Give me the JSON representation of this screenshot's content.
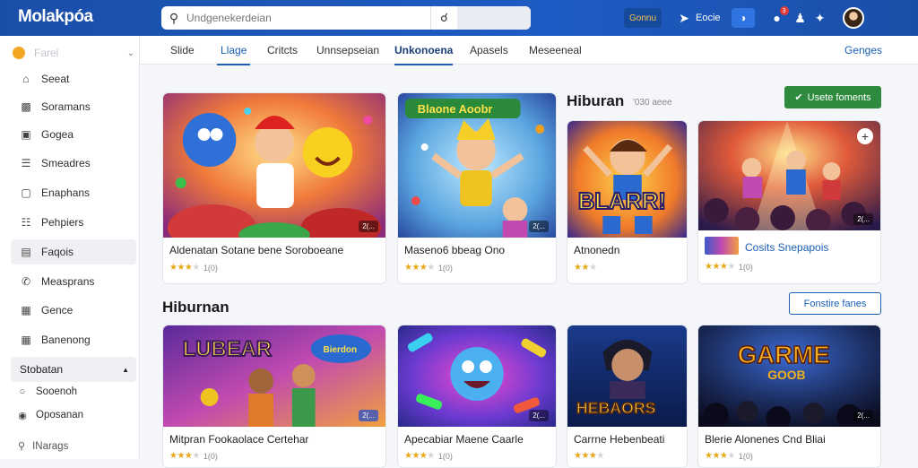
{
  "app": {
    "logo": "Molakpóa"
  },
  "search": {
    "placeholder": "Undgenekerdeian",
    "value": ""
  },
  "topbar": {
    "pill": "Gonnu",
    "link": "Eocie",
    "badge": "3"
  },
  "sidebar": {
    "header": "Farel",
    "items": [
      {
        "label": "Seeat",
        "icon": "home-icon"
      },
      {
        "label": "Soramans",
        "icon": "building-icon"
      },
      {
        "label": "Gogea",
        "icon": "briefcase-icon"
      },
      {
        "label": "Smeadres",
        "icon": "list-icon"
      },
      {
        "label": "Enaphans",
        "icon": "monitor-icon"
      },
      {
        "label": "Pehpiers",
        "icon": "bank-icon"
      },
      {
        "label": "Faqois",
        "icon": "document-icon"
      },
      {
        "label": "Measprans",
        "icon": "phone-icon"
      },
      {
        "label": "Gence",
        "icon": "calendar-icon"
      },
      {
        "label": "Banenong",
        "icon": "grid-icon"
      }
    ],
    "section": {
      "label": "Stobatan"
    },
    "sub_items": [
      {
        "label": "Sooenoh",
        "icon": "circle-icon"
      },
      {
        "label": "Oposanan",
        "icon": "globe-icon"
      }
    ],
    "footer": "INarags"
  },
  "tabs": [
    {
      "label": "Slide"
    },
    {
      "label": "Llage",
      "selected": true
    },
    {
      "label": "Critcts"
    },
    {
      "label": "Unnsepseian"
    },
    {
      "label": "Unkonoena",
      "bold": true
    },
    {
      "label": "Apasels"
    },
    {
      "label": "Meseeneal"
    },
    {
      "label": "Genges"
    }
  ],
  "section1": {
    "title": "Hiburan",
    "subtitle": "'030  aeee",
    "button": "Usete foments"
  },
  "section2": {
    "title": "Hiburnan",
    "button": "Fonstire fanes"
  },
  "cards_row1": [
    {
      "title": "Aldenatan Sotane bene Soroboeane",
      "rating": 3,
      "count": "1(0)",
      "tag": "2(..."
    },
    {
      "title": "Maseno6 bbeag Ono",
      "rating": 3,
      "count": "1(0)",
      "tag": "2(..."
    },
    {
      "title": "Atnonedn",
      "rating": 3,
      "count": "",
      "art_text": "BLARR!"
    },
    {
      "title": "Cosits Snepapois",
      "rating": 3,
      "count": "1(0)",
      "tag": "2(..."
    }
  ],
  "cards_row2": [
    {
      "title": "Mitpran Fookaolace Certehar",
      "rating": 3,
      "count": "1(0)",
      "tag": "2(...",
      "art_text": "LUBEAR"
    },
    {
      "title": "Apecabiar Maene Caarle",
      "rating": 3,
      "count": "1(0)",
      "tag": "2(..."
    },
    {
      "title": "Carrne Hebenbeati",
      "rating": 3,
      "count": "",
      "art_text": "HEBAORS"
    },
    {
      "title": "Blerie Alonenes Cnd Bliai",
      "rating": 3,
      "count": "1(0)",
      "tag": "2(...",
      "art_text": "GARME"
    }
  ],
  "card2_logo": "Blaone Aoobr",
  "card_lubear_bubble": "Bierdon",
  "card_game_sub": "GOOB",
  "colors": {
    "brand": "#1d5cc4",
    "accent_green": "#2e8b3e",
    "link": "#1b5fb8"
  }
}
